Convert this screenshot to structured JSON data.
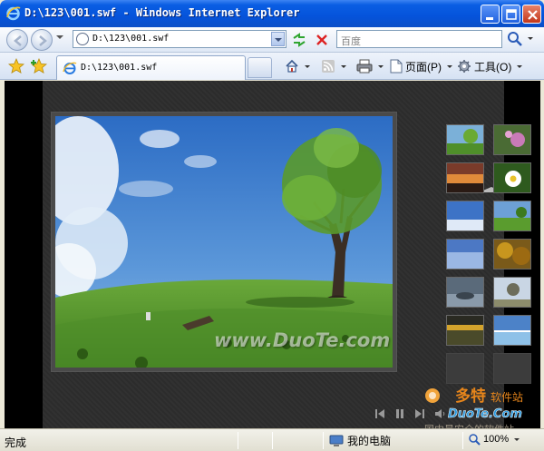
{
  "window": {
    "title": "D:\\123\\001.swf - Windows Internet Explorer",
    "buttons": [
      "minimize",
      "maximize",
      "close"
    ]
  },
  "address_bar": {
    "url": "D:\\123\\001.swf",
    "search_placeholder": "百度"
  },
  "tabs": [
    {
      "label": "D:\\123\\001.swf",
      "icon": "ie-page-icon",
      "active": true
    }
  ],
  "command_bar": {
    "home_icon": "home-icon",
    "feeds_icon": "rss-icon",
    "print_icon": "print-icon",
    "page_label": "页面(P)",
    "tools_label": "工具(O)"
  },
  "player": {
    "main_watermark": "www.DuoTe.com",
    "thumbnails": [
      "meadow-tree",
      "pink-flower",
      "sunset",
      "white-daisy",
      "blue-sky",
      "green-field",
      "blue-gradient",
      "autumn-forest",
      "rock-shore",
      "lone-tree",
      "golden-sunset",
      "sea-horizon",
      "empty",
      "empty"
    ],
    "controls": [
      "prev-icon",
      "pause-icon",
      "next-icon",
      "volume-icon"
    ]
  },
  "status_bar": {
    "status": "完成",
    "zone": "我的电脑",
    "zoom": "100%"
  },
  "site_logo": {
    "line1": "多特",
    "line1b": "软件站",
    "line2": "DuoTe.Com",
    "line3": "国内最安全的软件站"
  },
  "colors": {
    "titlebar": "#0553db",
    "player_bg": "#2d2d2d",
    "logo_orange": "#e8861b"
  }
}
